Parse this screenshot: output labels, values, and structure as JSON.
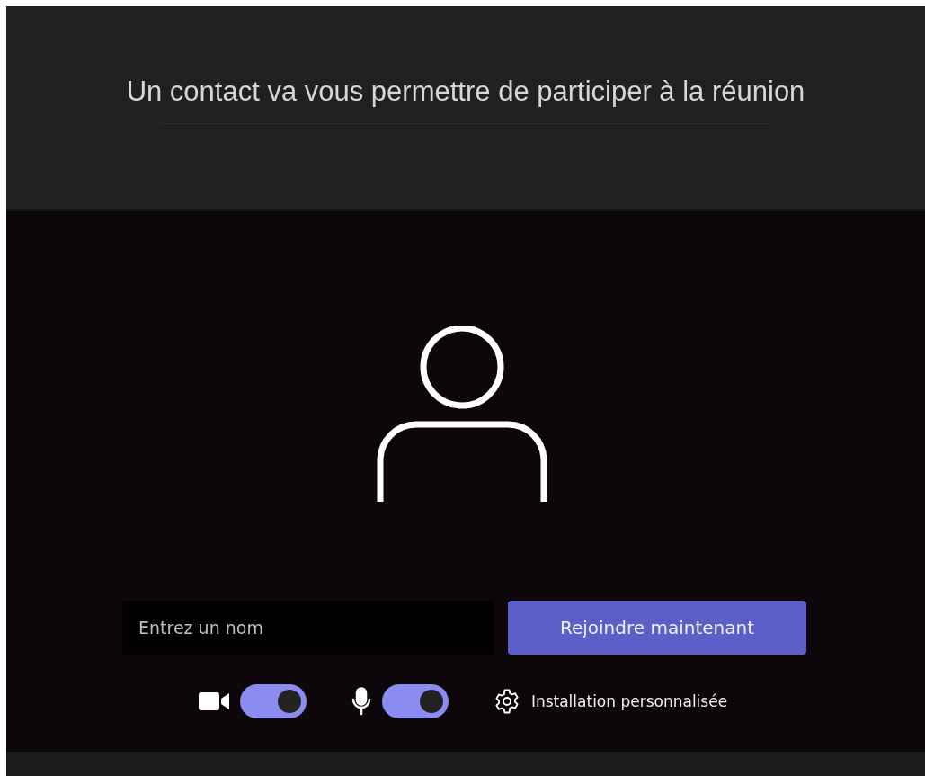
{
  "header": {
    "title": "Un contact va vous permettre de participer à la réunion"
  },
  "name_field": {
    "placeholder": "Entrez un nom"
  },
  "join_button": {
    "label": "Rejoindre maintenant"
  },
  "toggles": [
    {
      "kind": "camera",
      "on": true
    },
    {
      "kind": "microphone",
      "on": true
    }
  ],
  "settings_link": {
    "label": "Installation personnalisée"
  }
}
